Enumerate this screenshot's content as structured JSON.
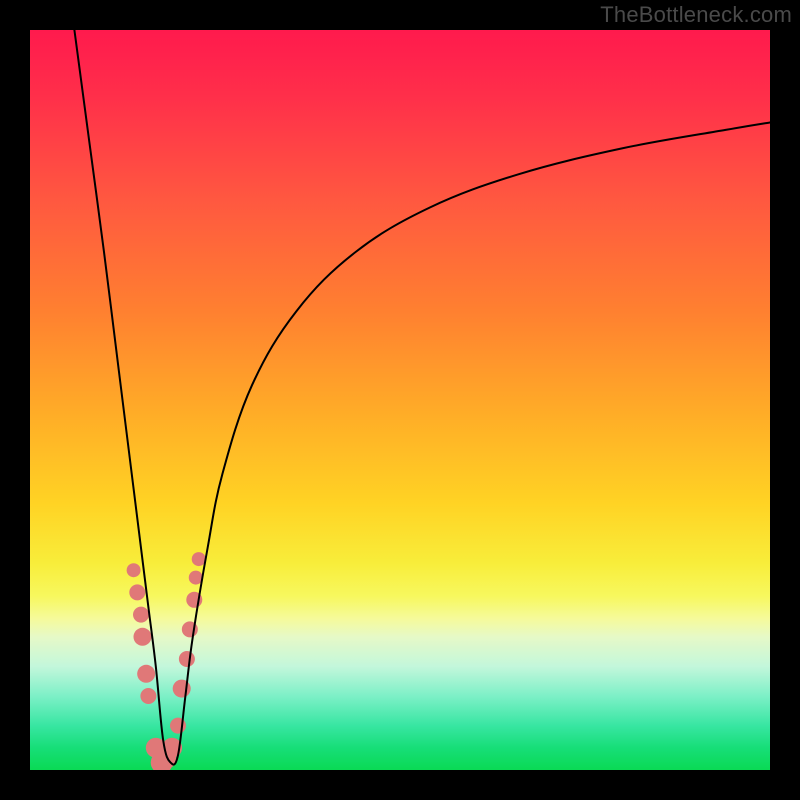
{
  "watermark": "TheBottleneck.com",
  "colors": {
    "marker": "#e07878",
    "curve_stroke": "#000000",
    "frame_background_top": "#ff1a4d",
    "frame_background_bottom": "#0ada54",
    "page_background": "#000000"
  },
  "chart_data": {
    "type": "line",
    "title": "",
    "xlabel": "",
    "ylabel": "",
    "xlim": [
      0,
      100
    ],
    "ylim": [
      0,
      100
    ],
    "grid": false,
    "legend": false,
    "description": "V-shaped bottleneck curve with minimum near x≈18; steep left descent, broad logarithmic right ascent.",
    "series": [
      {
        "name": "curve",
        "x": [
          6,
          8,
          10,
          12,
          14,
          15,
          16,
          17,
          18,
          19,
          20,
          21,
          22,
          24,
          26,
          30,
          36,
          44,
          54,
          66,
          80,
          94,
          100
        ],
        "y": [
          100,
          85,
          70,
          54,
          38,
          30,
          22,
          14,
          4,
          1,
          2,
          10,
          18,
          30,
          40,
          52,
          62,
          70,
          76,
          80.5,
          84,
          86.5,
          87.5
        ]
      }
    ],
    "markers": {
      "name": "highlight-points",
      "x": [
        14.0,
        14.5,
        15.0,
        15.2,
        15.7,
        16.0,
        17.0,
        17.8,
        18.4,
        19.2,
        20.0,
        20.5,
        21.2,
        21.6,
        22.2,
        22.4,
        22.8
      ],
      "y": [
        27.0,
        24.0,
        21.0,
        18.0,
        13.0,
        10.0,
        3.0,
        1.0,
        1.5,
        3.0,
        6.0,
        11.0,
        15.0,
        19.0,
        23.0,
        26.0,
        28.5
      ],
      "r": [
        7,
        8,
        8,
        9,
        9,
        8,
        10,
        11,
        10,
        10,
        8,
        9,
        8,
        8,
        8,
        7,
        7
      ]
    }
  }
}
